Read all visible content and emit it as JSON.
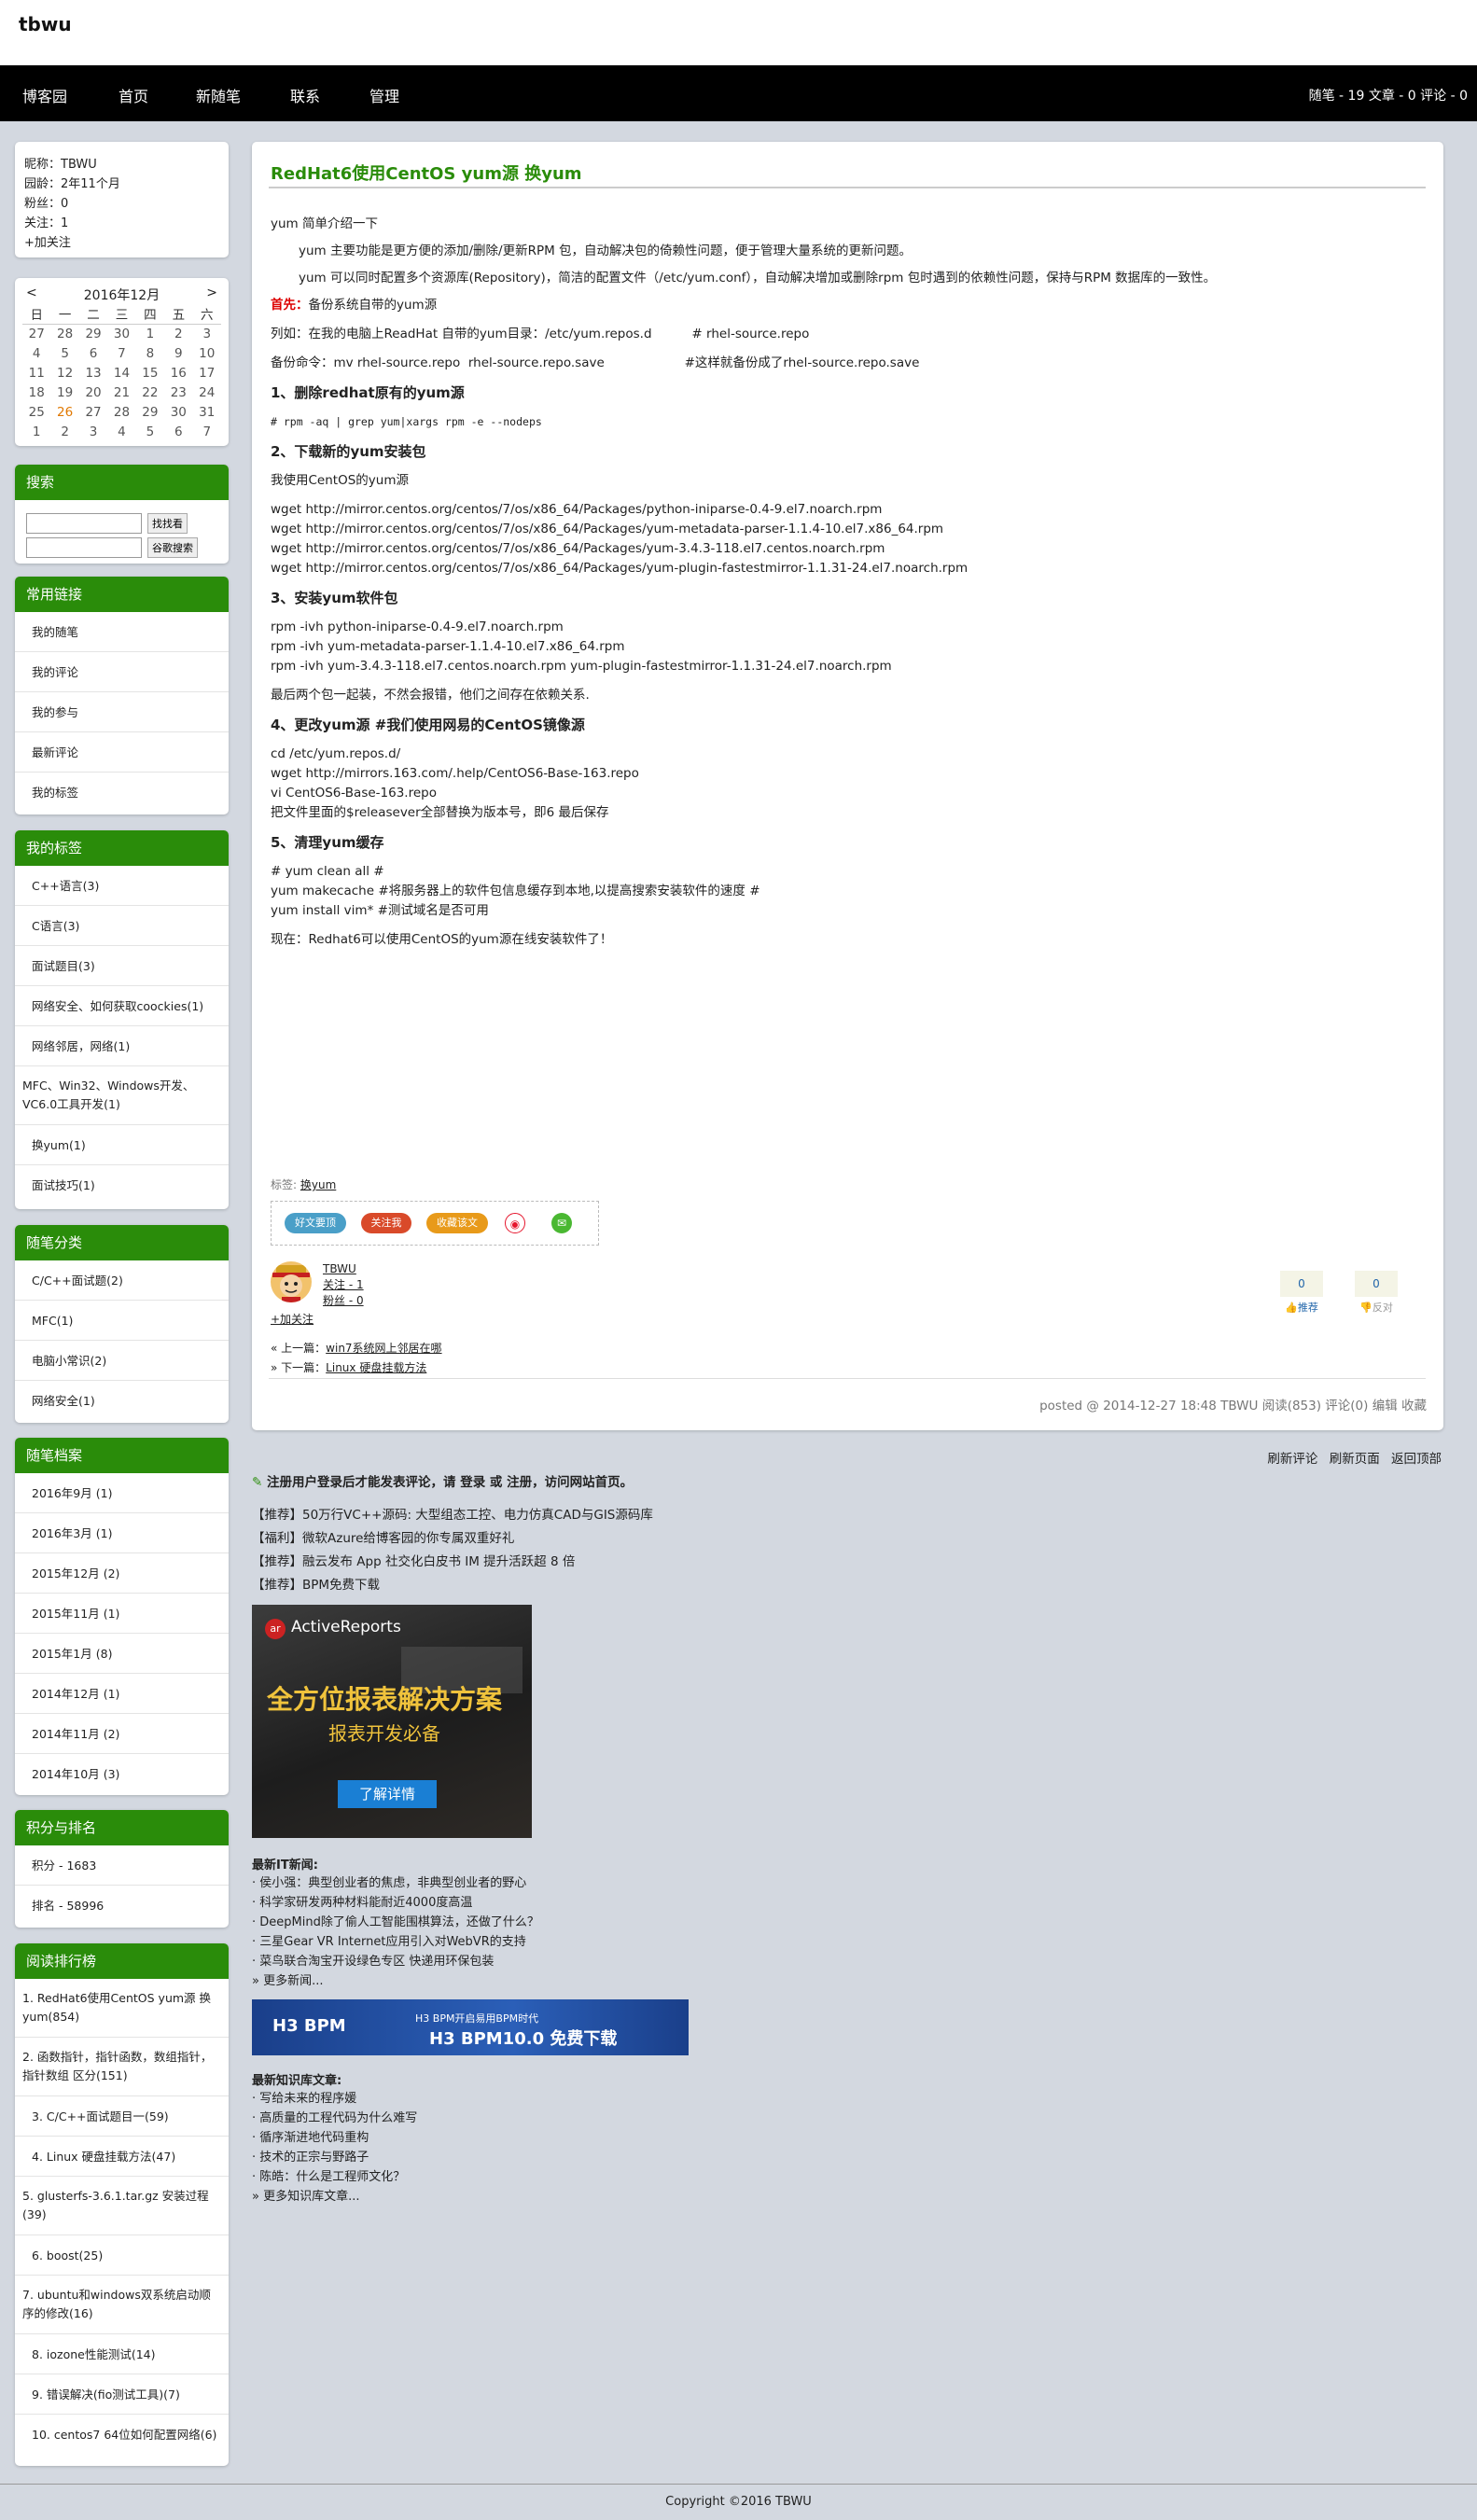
{
  "header": {
    "blog_title": "tbwu"
  },
  "nav": {
    "items": [
      "博客园",
      "首页",
      "新随笔",
      "联系",
      "管理"
    ],
    "stats": "随笔 - 19  文章 - 0  评论 - 0"
  },
  "profile": {
    "lines": [
      "昵称：TBWU",
      "园龄：2年11个月",
      "粉丝：0",
      "关注：1",
      "+加关注"
    ]
  },
  "calendar": {
    "prev": "<",
    "next": ">",
    "title": "2016年12月",
    "weekdays": [
      "日",
      "一",
      "二",
      "三",
      "四",
      "五",
      "六"
    ],
    "weeks": [
      [
        "27",
        "28",
        "29",
        "30",
        "1",
        "2",
        "3"
      ],
      [
        "4",
        "5",
        "6",
        "7",
        "8",
        "9",
        "10"
      ],
      [
        "11",
        "12",
        "13",
        "14",
        "15",
        "16",
        "17"
      ],
      [
        "18",
        "19",
        "20",
        "21",
        "22",
        "23",
        "24"
      ],
      [
        "25",
        "26",
        "27",
        "28",
        "29",
        "30",
        "31"
      ],
      [
        "1",
        "2",
        "3",
        "4",
        "5",
        "6",
        "7"
      ]
    ],
    "today": "26"
  },
  "search": {
    "title": "搜索",
    "btn1": "找找看",
    "btn2": "谷歌搜索"
  },
  "common_links": {
    "title": "常用链接",
    "items": [
      "我的随笔",
      "我的评论",
      "我的参与",
      "最新评论",
      "我的标签"
    ]
  },
  "my_tags": {
    "title": "我的标签",
    "items": [
      "C++语言(3)",
      "C语言(3)",
      "面试题目(3)",
      "网络安全、如何获取coockies(1)",
      "网络邻居，网络(1)",
      "MFC、Win32、Windows开发、VC6.0工具开发(1)",
      "换yum(1)",
      "面试技巧(1)"
    ]
  },
  "categories": {
    "title": "随笔分类",
    "items": [
      "C/C++面试题(2)",
      "MFC(1)",
      "电脑小常识(2)",
      "网络安全(1)"
    ]
  },
  "archives": {
    "title": "随笔档案",
    "items": [
      "2016年9月 (1)",
      "2016年3月 (1)",
      "2015年12月 (2)",
      "2015年11月 (1)",
      "2015年1月 (8)",
      "2014年12月 (1)",
      "2014年11月 (2)",
      "2014年10月 (3)"
    ]
  },
  "score": {
    "title": "积分与排名",
    "items": [
      "积分 - 1683",
      "排名 - 58996"
    ]
  },
  "top_read": {
    "title": "阅读排行榜",
    "items": [
      "1. RedHat6使用CentOS yum源 换yum(854)",
      "2. 函数指针，指针函数，数组指针，指针数组 区分(151)",
      "3. C/C++面试题目一(59)",
      "4. Linux 硬盘挂载方法(47)",
      "5. glusterfs-3.6.1.tar.gz 安装过程(39)",
      "6. boost(25)",
      "7. ubuntu和windows双系统启动顺序的修改(16)",
      "8. iozone性能测试(14)",
      "9. 错误解决(fio测试工具)(7)",
      "10. centos7 64位如何配置网络(6)"
    ]
  },
  "post": {
    "title": "RedHat6使用CentOS yum源 换yum",
    "p1": "yum 简单介绍一下",
    "p2": "yum 主要功能是更方便的添加/删除/更新RPM 包，自动解决包的倚赖性问题，便于管理大量系统的更新问题。",
    "p3": "yum 可以同时配置多个资源库(Repository)，简洁的配置文件（/etc/yum.conf），自动解决增加或删除rpm 包时遇到的依赖性问题，保持与RPM 数据库的一致性。",
    "first_label": "首先：",
    "first_text": "备份系统自带的yum源",
    "example": "列如：在我的电脑上ReadHat 自带的yum目录：/etc/yum.repos.d          # rhel-source.repo",
    "backup": "备份命令：mv rhel-source.repo  rhel-source.repo.save                    #这样就备份成了rhel-source.repo.save",
    "h1": "1、删除redhat原有的yum源",
    "cmd1": "# rpm -aq | grep yum|xargs rpm -e --nodeps",
    "h2": "2、下载新的yum安装包",
    "use": "我使用CentOS的yum源",
    "wget": [
      "wget  http://mirror.centos.org/centos/7/os/x86_64/Packages/python-iniparse-0.4-9.el7.noarch.rpm",
      "wget  http://mirror.centos.org/centos/7/os/x86_64/Packages/yum-metadata-parser-1.1.4-10.el7.x86_64.rpm",
      "wget  http://mirror.centos.org/centos/7/os/x86_64/Packages/yum-3.4.3-118.el7.centos.noarch.rpm",
      "wget  http://mirror.centos.org/centos/7/os/x86_64/Packages/yum-plugin-fastestmirror-1.1.31-24.el7.noarch.rpm"
    ],
    "h3": "3、安装yum软件包",
    "rpm": [
      "rpm -ivh python-iniparse-0.4-9.el7.noarch.rpm",
      "rpm -ivh yum-metadata-parser-1.1.4-10.el7.x86_64.rpm",
      "rpm -ivh yum-3.4.3-118.el7.centos.noarch.rpm yum-plugin-fastestmirror-1.1.31-24.el7.noarch.rpm"
    ],
    "note": "最后两个包一起装，不然会报错，他们之间存在依赖关系.",
    "h4": "4、更改yum源  #我们使用网易的CentOS镜像源",
    "s4": [
      "cd /etc/yum.repos.d/",
      "wget http://mirrors.163.com/.help/CentOS6-Base-163.repo",
      "vi CentOS6-Base-163.repo",
      "把文件里面的$releasever全部替换为版本号，即6 最后保存"
    ],
    "h5": "5、清理yum缓存",
    "s5": [
      "# yum clean all #",
      "yum makecache #将服务器上的软件包信息缓存到本地,以提高搜索安装软件的速度 #",
      "yum install vim* #测试域名是否可用"
    ],
    "final": "现在：Redhat6可以使用CentOS的yum源在线安装软件了！",
    "tags_label": "标签:",
    "tag": "换yum",
    "share": [
      "好文要顶",
      "关注我",
      "收藏该文"
    ],
    "author": {
      "name": "TBWU",
      "follow": "关注 - 1",
      "fans": "粉丝 - 0",
      "add": "+加关注"
    },
    "vote": {
      "up": "0",
      "up_label": "推荐",
      "down": "0",
      "down_label": "反对"
    },
    "prev": "« 上一篇：",
    "prev_link": "win7系统网上邻居在哪",
    "next": "» 下一篇：",
    "next_link": "Linux 硬盘挂载方法",
    "desc": "posted @ 2014-12-27 18:48 TBWU 阅读(853) 评论(0) 编辑 收藏"
  },
  "comment_ops": [
    "刷新评论",
    "刷新页面",
    "返回顶部"
  ],
  "comment_tip": "注册用户登录后才能发表评论，请 登录 或 注册，访问网站首页。",
  "ad_links": [
    "【推荐】50万行VC++源码: 大型组态工控、电力仿真CAD与GIS源码库",
    "【福利】微软Azure给博客园的你专属双重好礼",
    "【推荐】融云发布 App 社交化白皮书 IM 提升活跃超 8 倍",
    "【推荐】BPM免费下载"
  ],
  "ad_image": {
    "logo": "ActiveReports",
    "logo_mark": "ar",
    "h1": "全方位报表解决方案",
    "h2": "报表开发必备",
    "btn": "了解详情"
  },
  "news": {
    "title": "最新IT新闻:",
    "items": [
      "· 侯小强：典型创业者的焦虑，非典型创业者的野心",
      "· 科学家研发两种材料能耐近4000度高温",
      "· DeepMind除了偷人工智能围棋算法，还做了什么？",
      "· 三星Gear VR Internet应用引入对WebVR的支持",
      "· 菜鸟联合淘宝开设绿色专区 快递用环保包装",
      "» 更多新闻..."
    ]
  },
  "banner": {
    "logo": "H3 BPM",
    "t1": "H3 BPM开启易用BPM时代",
    "t2": "H3 BPM10.0 免费下载"
  },
  "kb": {
    "title": "最新知识库文章:",
    "items": [
      "· 写给未来的程序媛",
      "· 高质量的工程代码为什么难写",
      "· 循序渐进地代码重构",
      "· 技术的正宗与野路子",
      "· 陈皓：什么是工程师文化？",
      "» 更多知识库文章..."
    ]
  },
  "footer": {
    "copyright": "Copyright ©2016 TBWU"
  },
  "colors": {
    "accent": "#2a8c0a",
    "nav_bg": "#000000",
    "page_bg": "#d3d8e0"
  }
}
